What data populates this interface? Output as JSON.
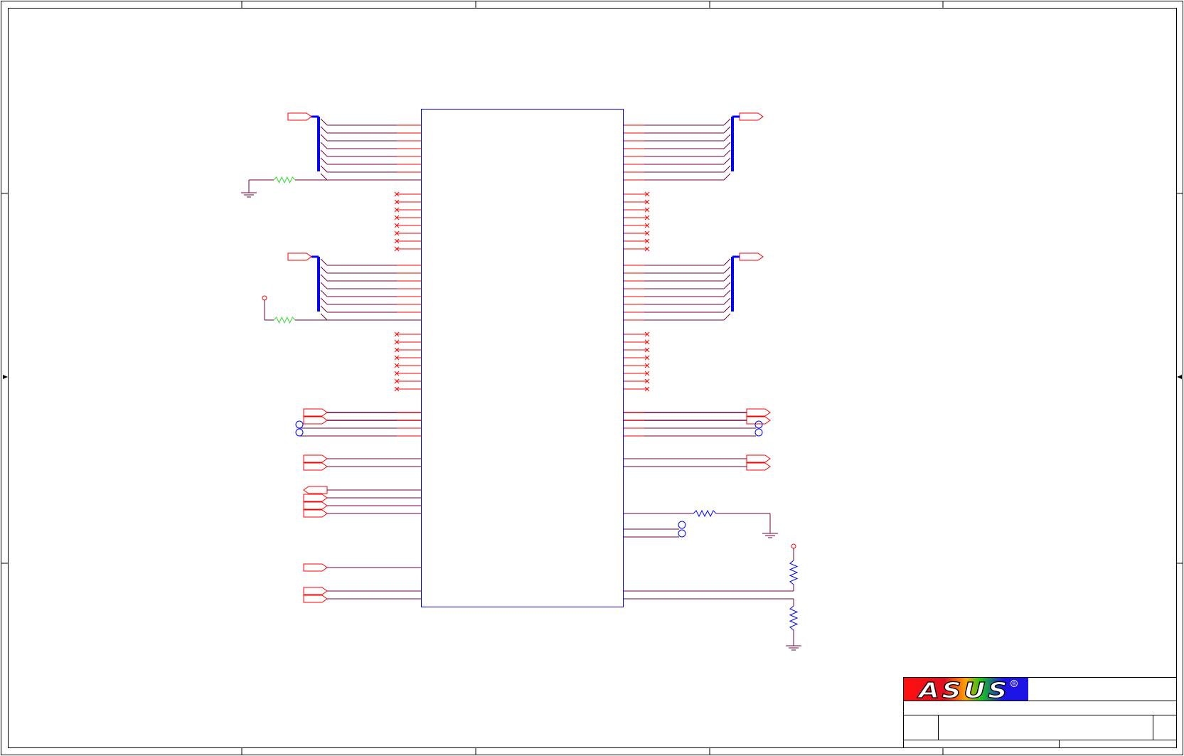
{
  "title_block": {
    "logo_text": "ASUS",
    "registered_mark": "®",
    "brand_colors": {
      "logo_red": "#ff1010",
      "logo_blue": "#1e14e6",
      "logo_orange": "#ffa500",
      "logo_green": "#19c819"
    }
  },
  "colors": {
    "frame": "#000000",
    "wire_red": "#ff0000",
    "wire_dark": "#70003a",
    "bus_blue": "#0000ff",
    "component_outline": "#0000ff",
    "resistor_green": "#33dd33",
    "resistor_blue": "#0000ff",
    "test_point_blue": "#0000ff"
  }
}
